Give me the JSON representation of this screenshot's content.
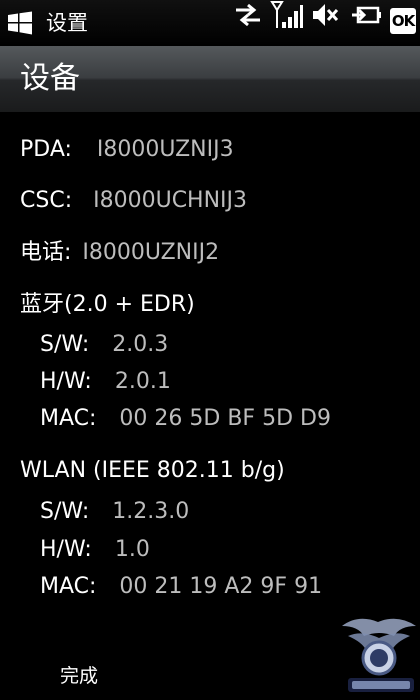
{
  "statusbar": {
    "title": "设置",
    "ok_label": "OK",
    "icons": [
      "windows-start-icon",
      "data-transfer-icon",
      "signal-strength-icon",
      "volume-muted-icon",
      "battery-charging-icon"
    ]
  },
  "header": {
    "title": "设备"
  },
  "firmware": {
    "pda": {
      "label": "PDA:",
      "value": "I8000UZNIJ3"
    },
    "csc": {
      "label": "CSC:",
      "value": "I8000UCHNIJ3"
    },
    "phone": {
      "label": "电话:",
      "value": "I8000UZNIJ2"
    }
  },
  "bluetooth": {
    "heading": "蓝牙(2.0 + EDR)",
    "sw": {
      "label": "S/W:",
      "value": "2.0.3"
    },
    "hw": {
      "label": "H/W:",
      "value": "2.0.1"
    },
    "mac": {
      "label": "MAC:",
      "value": "00 26 5D BF 5D D9"
    }
  },
  "wlan": {
    "heading": "WLAN (IEEE 802.11 b/g)",
    "sw": {
      "label": "S/W:",
      "value": "1.2.3.0"
    },
    "hw": {
      "label": "H/W:",
      "value": "1.0"
    },
    "mac": {
      "label": "MAC:",
      "value": "00 21 19 A2 9F 91"
    }
  },
  "menubar": {
    "left_label": "完成"
  }
}
